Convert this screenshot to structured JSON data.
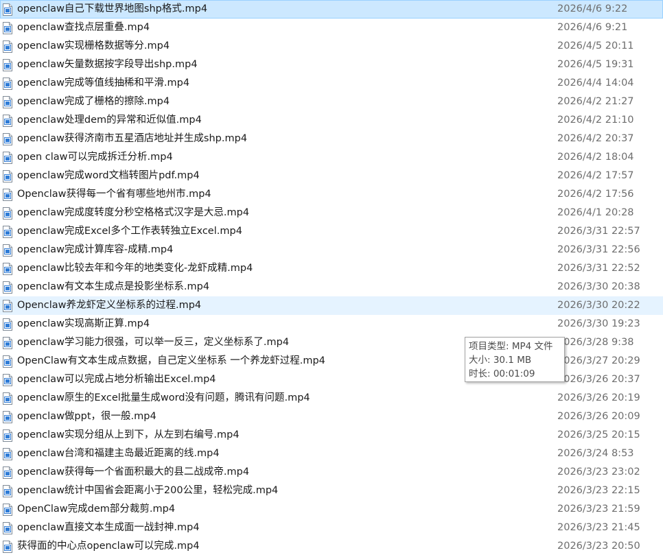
{
  "colors": {
    "selected_bg": "#cce8ff",
    "hover_bg": "#e5f3ff",
    "date_text": "#6d6d6d",
    "icon_accent": "#2e7bd6"
  },
  "files": [
    {
      "name": "openclaw自己下载世界地图shp格式.mp4",
      "date": "2026/4/6 9:22",
      "icon": "video-file-icon"
    },
    {
      "name": "openclaw查找点层重叠.mp4",
      "date": "2026/4/6 9:21",
      "icon": "video-file-icon"
    },
    {
      "name": "openclaw实现栅格数据等分.mp4",
      "date": "2026/4/5 20:11",
      "icon": "video-file-icon"
    },
    {
      "name": "openclaw矢量数据按字段导出shp.mp4",
      "date": "2026/4/5 19:31",
      "icon": "video-file-icon"
    },
    {
      "name": "openclaw完成等值线抽稀和平滑.mp4",
      "date": "2026/4/4 14:04",
      "icon": "video-file-icon"
    },
    {
      "name": "openclaw完成了栅格的擦除.mp4",
      "date": "2026/4/2 21:27",
      "icon": "video-file-icon"
    },
    {
      "name": "openclaw处理dem的异常和近似值.mp4",
      "date": "2026/4/2 21:10",
      "icon": "video-file-icon"
    },
    {
      "name": "openclaw获得济南市五星酒店地址并生成shp.mp4",
      "date": "2026/4/2 20:37",
      "icon": "video-file-icon"
    },
    {
      "name": "open claw可以完成拆迁分析.mp4",
      "date": "2026/4/2 18:04",
      "icon": "video-file-icon"
    },
    {
      "name": "openclaw完成word文档转图片pdf.mp4",
      "date": "2026/4/2 17:57",
      "icon": "video-file-icon"
    },
    {
      "name": "Openclaw获得每一个省有哪些地州市.mp4",
      "date": "2026/4/2 17:56",
      "icon": "video-file-icon"
    },
    {
      "name": "openclaw完成度转度分秒空格格式汉字是大忌.mp4",
      "date": "2026/4/1 20:28",
      "icon": "video-file-icon"
    },
    {
      "name": "openclaw完成Excel多个工作表转独立Excel.mp4",
      "date": "2026/3/31 22:57",
      "icon": "video-file-icon"
    },
    {
      "name": "openclaw完成计算库容-成精.mp4",
      "date": "2026/3/31 22:56",
      "icon": "video-file-icon"
    },
    {
      "name": "openclaw比较去年和今年的地类变化-龙虾成精.mp4",
      "date": "2026/3/31 22:52",
      "icon": "video-file-icon"
    },
    {
      "name": "openclaw有文本生成点是投影坐标系.mp4",
      "date": "2026/3/30 20:38",
      "icon": "video-file-icon"
    },
    {
      "name": "Openclaw养龙虾定义坐标系的过程.mp4",
      "date": "2026/3/30 20:22",
      "icon": "video-file-icon"
    },
    {
      "name": "openclaw实现高斯正算.mp4",
      "date": "2026/3/30 19:23",
      "icon": "video-file-icon"
    },
    {
      "name": "openclaw学习能力很强，可以举一反三，定义坐标系了.mp4",
      "date": "2026/3/28 9:38",
      "icon": "video-file-icon"
    },
    {
      "name": "OpenClaw有文本生成点数据，自己定义坐标系 一个养龙虾过程.mp4",
      "date": "2026/3/27 20:29",
      "icon": "video-file-icon"
    },
    {
      "name": "openclaw可以完成占地分析输出Excel.mp4",
      "date": "2026/3/26 20:37",
      "icon": "video-file-icon"
    },
    {
      "name": "openclaw原生的Excel批量生成word没有问题，腾讯有问题.mp4",
      "date": "2026/3/26 20:19",
      "icon": "video-file-icon"
    },
    {
      "name": "openclaw做ppt，很一般.mp4",
      "date": "2026/3/26 20:09",
      "icon": "video-file-icon"
    },
    {
      "name": "openclaw实现分组从上到下，从左到右编号.mp4",
      "date": "2026/3/25 20:15",
      "icon": "video-file-icon"
    },
    {
      "name": "openclaw台湾和福建主岛最近距离的线.mp4",
      "date": "2026/3/24 8:53",
      "icon": "video-file-icon"
    },
    {
      "name": "openclaw获得每一个省面积最大的县二战成帝.mp4",
      "date": "2026/3/23 23:02",
      "icon": "video-file-icon"
    },
    {
      "name": "openclaw统计中国省会距离小于200公里，轻松完成.mp4",
      "date": "2026/3/23 22:15",
      "icon": "video-file-icon"
    },
    {
      "name": "OpenClaw完成dem部分裁剪.mp4",
      "date": "2026/3/23 21:59",
      "icon": "video-file-icon"
    },
    {
      "name": "openclaw直接文本生成面一战封神.mp4",
      "date": "2026/3/23 21:45",
      "icon": "video-file-icon"
    },
    {
      "name": "获得面的中心点openclaw可以完成.mp4",
      "date": "2026/3/23 20:50",
      "icon": "video-file-icon"
    }
  ],
  "tooltip": {
    "type_line": "项目类型: MP4 文件",
    "size_line": "大小: 30.1 MB",
    "duration_line": "时长: 00:01:09"
  }
}
